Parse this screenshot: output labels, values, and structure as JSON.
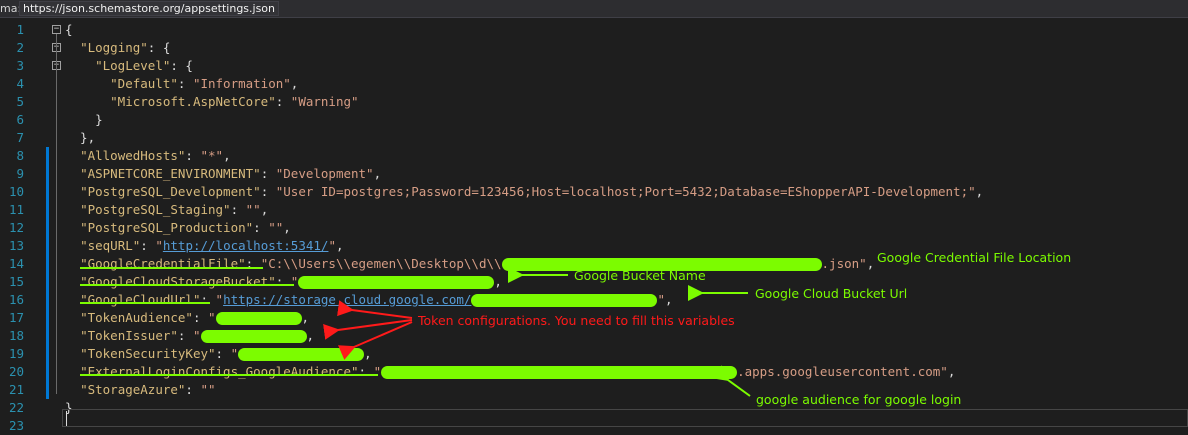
{
  "schema_bar": {
    "label": "ma:",
    "url": "https://json.schemastore.org/appsettings.json"
  },
  "lines": [
    {
      "num": "1",
      "fold": "-",
      "changed": false,
      "segments": [
        {
          "t": "p",
          "v": "{"
        }
      ]
    },
    {
      "num": "2",
      "fold": "-",
      "changed": false,
      "segments": [
        {
          "t": "p",
          "v": "  "
        },
        {
          "t": "k",
          "v": "\"Logging\""
        },
        {
          "t": "p",
          "v": ": {"
        }
      ]
    },
    {
      "num": "3",
      "fold": "-",
      "changed": false,
      "segments": [
        {
          "t": "p",
          "v": "    "
        },
        {
          "t": "k",
          "v": "\"LogLevel\""
        },
        {
          "t": "p",
          "v": ": {"
        }
      ]
    },
    {
      "num": "4",
      "changed": false,
      "segments": [
        {
          "t": "p",
          "v": "      "
        },
        {
          "t": "k",
          "v": "\"Default\""
        },
        {
          "t": "p",
          "v": ": "
        },
        {
          "t": "s",
          "v": "\"Information\""
        },
        {
          "t": "p",
          "v": ","
        }
      ]
    },
    {
      "num": "5",
      "changed": false,
      "segments": [
        {
          "t": "p",
          "v": "      "
        },
        {
          "t": "k",
          "v": "\"Microsoft.AspNetCore\""
        },
        {
          "t": "p",
          "v": ": "
        },
        {
          "t": "s",
          "v": "\"Warning\""
        }
      ]
    },
    {
      "num": "6",
      "changed": false,
      "segments": [
        {
          "t": "p",
          "v": "    }"
        }
      ]
    },
    {
      "num": "7",
      "changed": false,
      "segments": [
        {
          "t": "p",
          "v": "  },"
        }
      ]
    },
    {
      "num": "8",
      "changed": true,
      "segments": [
        {
          "t": "p",
          "v": "  "
        },
        {
          "t": "k",
          "v": "\"AllowedHosts\""
        },
        {
          "t": "p",
          "v": ": "
        },
        {
          "t": "s",
          "v": "\"*\""
        },
        {
          "t": "p",
          "v": ","
        }
      ]
    },
    {
      "num": "9",
      "changed": true,
      "segments": [
        {
          "t": "p",
          "v": "  "
        },
        {
          "t": "k",
          "v": "\"ASPNETCORE_ENVIRONMENT\""
        },
        {
          "t": "p",
          "v": ": "
        },
        {
          "t": "s",
          "v": "\"Development\""
        },
        {
          "t": "p",
          "v": ","
        }
      ]
    },
    {
      "num": "10",
      "changed": true,
      "segments": [
        {
          "t": "p",
          "v": "  "
        },
        {
          "t": "k",
          "v": "\"PostgreSQL_Development\""
        },
        {
          "t": "p",
          "v": ": "
        },
        {
          "t": "s",
          "v": "\"User ID=postgres;Password=123456;Host=localhost;Port=5432;Database=EShopperAPI-Development;\""
        },
        {
          "t": "p",
          "v": ","
        }
      ]
    },
    {
      "num": "11",
      "changed": true,
      "segments": [
        {
          "t": "p",
          "v": "  "
        },
        {
          "t": "k",
          "v": "\"PostgreSQL_Staging\""
        },
        {
          "t": "p",
          "v": ": "
        },
        {
          "t": "s",
          "v": "\"\""
        },
        {
          "t": "p",
          "v": ","
        }
      ]
    },
    {
      "num": "12",
      "changed": true,
      "segments": [
        {
          "t": "p",
          "v": "  "
        },
        {
          "t": "k",
          "v": "\"PostgreSQL_Production\""
        },
        {
          "t": "p",
          "v": ": "
        },
        {
          "t": "s",
          "v": "\"\""
        },
        {
          "t": "p",
          "v": ","
        }
      ]
    },
    {
      "num": "13",
      "changed": true,
      "segments": [
        {
          "t": "p",
          "v": "  "
        },
        {
          "t": "k",
          "v": "\"seqURL\""
        },
        {
          "t": "p",
          "v": ": "
        },
        {
          "t": "s",
          "v": "\""
        },
        {
          "t": "u",
          "v": "http://localhost:5341/"
        },
        {
          "t": "s",
          "v": "\""
        },
        {
          "t": "p",
          "v": ","
        }
      ]
    },
    {
      "num": "14",
      "changed": true,
      "segments": [
        {
          "t": "p",
          "v": "  "
        },
        {
          "t": "k",
          "v": "\"GoogleCredentialFile\""
        },
        {
          "t": "p",
          "v": ": "
        },
        {
          "t": "s",
          "v": "\"C:\\\\Users\\\\egemen\\\\Desktop\\\\d\\\\"
        },
        {
          "t": "r",
          "w": 320
        },
        {
          "t": "s",
          "v": ".json\""
        },
        {
          "t": "p",
          "v": ","
        }
      ]
    },
    {
      "num": "15",
      "changed": true,
      "segments": [
        {
          "t": "p",
          "v": "  "
        },
        {
          "t": "k",
          "v": "\"GoogleCloudStorageBucket\""
        },
        {
          "t": "p",
          "v": ": "
        },
        {
          "t": "s",
          "v": "\""
        },
        {
          "t": "r",
          "w": 196
        },
        {
          "t": "p",
          "v": ","
        }
      ]
    },
    {
      "num": "16",
      "changed": true,
      "segments": [
        {
          "t": "p",
          "v": "  "
        },
        {
          "t": "k",
          "v": "\"GoogleCloudUrl\""
        },
        {
          "t": "p",
          "v": ": "
        },
        {
          "t": "s",
          "v": "\""
        },
        {
          "t": "u",
          "v": "https://storage.cloud.google.com/"
        },
        {
          "t": "r",
          "w": 186
        },
        {
          "t": "s",
          "v": "\""
        },
        {
          "t": "p",
          "v": ","
        }
      ]
    },
    {
      "num": "17",
      "changed": true,
      "segments": [
        {
          "t": "p",
          "v": "  "
        },
        {
          "t": "k",
          "v": "\"TokenAudience\""
        },
        {
          "t": "p",
          "v": ": "
        },
        {
          "t": "s",
          "v": "\""
        },
        {
          "t": "r",
          "w": 86
        },
        {
          "t": "p",
          "v": ","
        }
      ]
    },
    {
      "num": "18",
      "changed": true,
      "segments": [
        {
          "t": "p",
          "v": "  "
        },
        {
          "t": "k",
          "v": "\"TokenIssuer\""
        },
        {
          "t": "p",
          "v": ": "
        },
        {
          "t": "s",
          "v": "\""
        },
        {
          "t": "r",
          "w": 106
        },
        {
          "t": "p",
          "v": ","
        }
      ]
    },
    {
      "num": "19",
      "changed": true,
      "segments": [
        {
          "t": "p",
          "v": "  "
        },
        {
          "t": "k",
          "v": "\"TokenSecurityKey\""
        },
        {
          "t": "p",
          "v": ": "
        },
        {
          "t": "s",
          "v": "\""
        },
        {
          "t": "r",
          "w": 126
        },
        {
          "t": "p",
          "v": ","
        }
      ]
    },
    {
      "num": "20",
      "changed": true,
      "segments": [
        {
          "t": "p",
          "v": "  "
        },
        {
          "t": "k",
          "v": "\"ExternalLoginConfigs_GoogleAudience\""
        },
        {
          "t": "p",
          "v": ": "
        },
        {
          "t": "s",
          "v": "\""
        },
        {
          "t": "r",
          "w": 356
        },
        {
          "t": "s",
          "v": ".apps.googleusercontent.com\""
        },
        {
          "t": "p",
          "v": ","
        }
      ]
    },
    {
      "num": "21",
      "changed": true,
      "segments": [
        {
          "t": "p",
          "v": "  "
        },
        {
          "t": "k",
          "v": "\"StorageAzure\""
        },
        {
          "t": "p",
          "v": ": "
        },
        {
          "t": "s",
          "v": "\"\""
        }
      ]
    },
    {
      "num": "22",
      "changed": false,
      "segments": [
        {
          "t": "p",
          "v": "}"
        }
      ]
    },
    {
      "num": "23",
      "changed": false,
      "segments": []
    }
  ],
  "annotations": {
    "credential_file": "Google Credential File Location",
    "bucket_name": "Google Bucket Name",
    "bucket_url": "Google Cloud Bucket Url",
    "token": "Token configurations. You need to fill this variables",
    "audience": "google audience for google login"
  },
  "colors": {
    "key": "#d7ba7d",
    "string": "#d69d85",
    "url": "#569cd6",
    "line_number": "#2b91af",
    "highlight": "#7cfc00",
    "annotation_red": "#ff1a1a"
  }
}
